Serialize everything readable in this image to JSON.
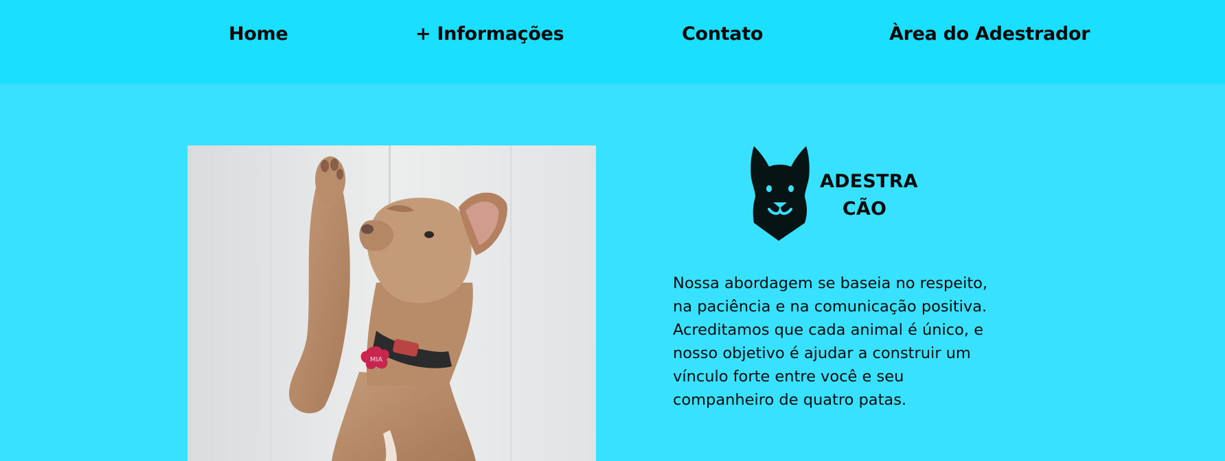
{
  "nav": {
    "items": [
      {
        "label": "Home"
      },
      {
        "label": "+ Informações"
      },
      {
        "label": "Contato"
      },
      {
        "label": "Àrea do Adestrador"
      }
    ]
  },
  "logo": {
    "line1": "ADESTRA",
    "line2": "CÃO"
  },
  "about": {
    "text": "Nossa abordagem se baseia no respeito, na paciência e na comunicação positiva. Acreditamos que cada animal é único, e nosso objetivo é ajudar a construir um vínculo forte entre você e seu companheiro de quatro patas."
  },
  "photo": {
    "tag_text": "MIA"
  },
  "colors": {
    "nav_bg": "#1bdfff",
    "page_bg": "#38e1ff",
    "text": "#0b0b0b"
  }
}
